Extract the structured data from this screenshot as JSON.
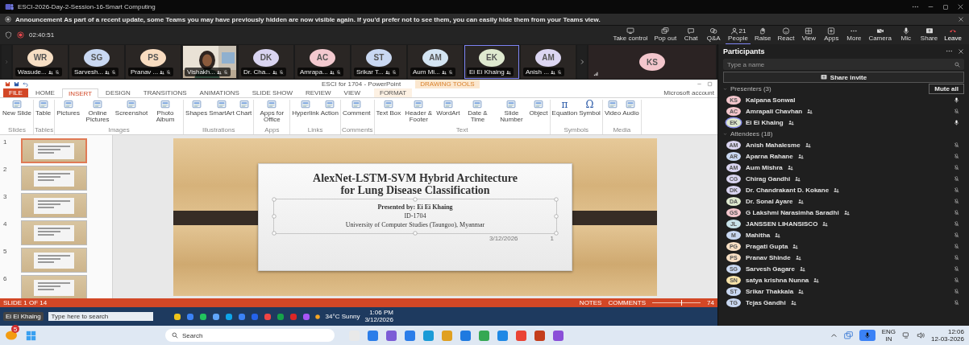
{
  "window": {
    "title": "ESCI-2026-Day-2-Session-16-Smart Computing"
  },
  "announcement": {
    "text": "Announcement As part of a recent update, some Teams you may have previously hidden are now visible again. If you'd prefer not to see them, you can easily hide them from your Teams view."
  },
  "meeting_bar": {
    "timer": "02:40:51",
    "actions": [
      {
        "label": "Take control",
        "selected": false
      },
      {
        "label": "Pop out",
        "selected": false
      },
      {
        "label": "Chat",
        "selected": false
      },
      {
        "label": "Q&A",
        "selected": false
      },
      {
        "label": "People",
        "count": "21",
        "selected": true
      },
      {
        "label": "Raise",
        "selected": false
      },
      {
        "label": "React",
        "selected": false
      },
      {
        "label": "View",
        "selected": false
      },
      {
        "label": "Apps",
        "selected": false
      },
      {
        "label": "More",
        "selected": false
      },
      {
        "label": "Camera",
        "selected": false
      },
      {
        "label": "Mic",
        "selected": false
      },
      {
        "label": "Share",
        "selected": false
      },
      {
        "label": "Leave",
        "selected": false
      }
    ]
  },
  "video_tiles": [
    {
      "kind": "avatar",
      "initials": "WR",
      "name": "Wasude...",
      "color": "#f7dfc4",
      "muted": true,
      "selected": false
    },
    {
      "kind": "avatar",
      "initials": "SG",
      "name": "Sarvesh...",
      "color": "#c9d8f2",
      "muted": true,
      "selected": false
    },
    {
      "kind": "avatar",
      "initials": "PS",
      "name": "Pranav ...",
      "color": "#f8dcc0",
      "muted": true,
      "selected": false
    },
    {
      "kind": "picture",
      "name": "Vishakh...",
      "muted": true,
      "selected": false
    },
    {
      "kind": "avatar",
      "initials": "DK",
      "name": "Dr. Cha...",
      "color": "#d9d4f0",
      "muted": true,
      "selected": false
    },
    {
      "kind": "avatar",
      "initials": "AC",
      "name": "Amrapa...",
      "color": "#f3c9cf",
      "muted": true,
      "selected": false
    },
    {
      "kind": "avatar",
      "initials": "ST",
      "name": "Srikar T...",
      "color": "#c9d8f2",
      "muted": true,
      "selected": false
    },
    {
      "kind": "avatar",
      "initials": "AM",
      "name": "Aum Mi...",
      "color": "#d3e4f2",
      "muted": true,
      "selected": false
    },
    {
      "kind": "avatar",
      "initials": "EK",
      "name": "Ei Ei Khaing",
      "color": "#dfe9cf",
      "muted": false,
      "selected": true
    },
    {
      "kind": "avatar",
      "initials": "AM",
      "name": "Anish ...",
      "color": "#dcd6f2",
      "muted": true,
      "selected": false
    }
  ],
  "featured_tile": {
    "initials": "KS",
    "color": "#f3c6cc"
  },
  "participants": {
    "title": "Participants",
    "search": {
      "placeholder": "Type a name"
    },
    "share_button": "Share invite",
    "mute_all": "Mute all",
    "groups": [
      {
        "label": "Presenters (3)",
        "members": [
          {
            "initials": "KS",
            "name": "Kalpana Sonwal",
            "color": "#f3c6cc",
            "badge": false,
            "muted": false,
            "speaking": false
          },
          {
            "initials": "AC",
            "name": "Amrapali Chavhan",
            "color": "#f3c6cc",
            "badge": true,
            "muted": true,
            "speaking": false
          },
          {
            "initials": "EK",
            "name": "Ei Ei Khaing",
            "color": "#dfe9cf",
            "badge": true,
            "muted": false,
            "speaking": true
          }
        ]
      },
      {
        "label": "Attendees (18)",
        "members": [
          {
            "initials": "AM",
            "name": "Anish Mahalesme",
            "color": "#d9d4f0",
            "badge": true,
            "muted": true,
            "speaking": false
          },
          {
            "initials": "AR",
            "name": "Aparna Rahane",
            "color": "#c9d8f2",
            "badge": true,
            "muted": true,
            "speaking": false
          },
          {
            "initials": "AM",
            "name": "Aum Mishra",
            "color": "#d9d4f0",
            "badge": true,
            "muted": true,
            "speaking": false
          },
          {
            "initials": "CG",
            "name": "Chirag Gandhi",
            "color": "#d9d4f0",
            "badge": true,
            "muted": true,
            "speaking": false
          },
          {
            "initials": "DK",
            "name": "Dr. Chandrakant D. Kokane",
            "color": "#d9d4f0",
            "badge": true,
            "muted": true,
            "speaking": false
          },
          {
            "initials": "DA",
            "name": "Dr. Sonal Ayare",
            "color": "#dfe9cf",
            "badge": true,
            "muted": true,
            "speaking": false
          },
          {
            "initials": "GS",
            "name": "G Lakshmi Narasimha Saradhi",
            "color": "#f3c6cc",
            "badge": true,
            "muted": true,
            "speaking": false
          },
          {
            "initials": "JL",
            "name": "JANSSEN LIHANSISCO",
            "color": "#c9e3ea",
            "badge": true,
            "muted": true,
            "speaking": false
          },
          {
            "initials": "M",
            "name": "Mahitha",
            "color": "#c9d8f2",
            "badge": true,
            "muted": true,
            "speaking": false
          },
          {
            "initials": "PG",
            "name": "Pragati Gupta",
            "color": "#f7dfc4",
            "badge": true,
            "muted": true,
            "speaking": false
          },
          {
            "initials": "PS",
            "name": "Pranav Shinde",
            "color": "#f7dfc4",
            "badge": true,
            "muted": true,
            "speaking": false
          },
          {
            "initials": "SG",
            "name": "Sarvesh Gagare",
            "color": "#c9d8f2",
            "badge": true,
            "muted": true,
            "speaking": false
          },
          {
            "initials": "SN",
            "name": "satya krishna Nunna",
            "color": "#f6e2a8",
            "badge": true,
            "muted": true,
            "speaking": false
          },
          {
            "initials": "ST",
            "name": "Srikar Thakkala",
            "color": "#c9d8f2",
            "badge": true,
            "muted": true,
            "speaking": false
          },
          {
            "initials": "TG",
            "name": "Tejas Gandhi",
            "color": "#c9d8f2",
            "badge": true,
            "muted": true,
            "speaking": false
          }
        ]
      }
    ]
  },
  "powerpoint": {
    "title": "ESCI for 1704 - PowerPoint",
    "contextual_label": "DRAWING TOOLS",
    "account": "Microsoft account",
    "tabs": [
      {
        "label": "FILE",
        "kind": "file",
        "selected": false
      },
      {
        "label": "HOME",
        "kind": "tab",
        "selected": false
      },
      {
        "label": "INSERT",
        "kind": "tab",
        "selected": true
      },
      {
        "label": "DESIGN",
        "kind": "tab",
        "selected": false
      },
      {
        "label": "TRANSITIONS",
        "kind": "tab",
        "selected": false
      },
      {
        "label": "ANIMATIONS",
        "kind": "tab",
        "selected": false
      },
      {
        "label": "SLIDE SHOW",
        "kind": "tab",
        "selected": false
      },
      {
        "label": "REVIEW",
        "kind": "tab",
        "selected": false
      },
      {
        "label": "VIEW",
        "kind": "tab",
        "selected": false
      },
      {
        "label": "FORMAT",
        "kind": "contextual",
        "selected": false
      }
    ],
    "ribbon_groups": [
      {
        "label": "Slides",
        "buttons": [
          {
            "label": "New Slide"
          }
        ]
      },
      {
        "label": "Tables",
        "buttons": [
          {
            "label": "Table"
          }
        ]
      },
      {
        "label": "Images",
        "buttons": [
          {
            "label": "Pictures"
          },
          {
            "label": "Online Pictures"
          },
          {
            "label": "Screenshot"
          },
          {
            "label": "Photo Album"
          }
        ]
      },
      {
        "label": "Illustrations",
        "buttons": [
          {
            "label": "Shapes"
          },
          {
            "label": "SmartArt"
          },
          {
            "label": "Chart"
          }
        ]
      },
      {
        "label": "Apps",
        "buttons": [
          {
            "label": "Apps for Office"
          }
        ]
      },
      {
        "label": "Links",
        "buttons": [
          {
            "label": "Hyperlink"
          },
          {
            "label": "Action"
          }
        ]
      },
      {
        "label": "Comments",
        "buttons": [
          {
            "label": "Comment"
          }
        ]
      },
      {
        "label": "Text",
        "buttons": [
          {
            "label": "Text Box"
          },
          {
            "label": "Header & Footer"
          },
          {
            "label": "WordArt"
          },
          {
            "label": "Date & Time"
          },
          {
            "label": "Slide Number"
          },
          {
            "label": "Object"
          }
        ]
      },
      {
        "label": "Symbols",
        "buttons": [
          {
            "label": "Equation",
            "glyph": "π"
          },
          {
            "label": "Symbol",
            "glyph": "Ω"
          }
        ]
      },
      {
        "label": "Media",
        "buttons": [
          {
            "label": "Video"
          },
          {
            "label": "Audio"
          }
        ]
      }
    ],
    "thumbnails": [
      {
        "number": "1",
        "selected": true
      },
      {
        "number": "2",
        "selected": false
      },
      {
        "number": "3",
        "selected": false
      },
      {
        "number": "4",
        "selected": false
      },
      {
        "number": "5",
        "selected": false
      },
      {
        "number": "6",
        "selected": false
      }
    ],
    "slide": {
      "title": "AlexNet-LSTM-SVM Hybrid Architecture for Lung Disease Classification",
      "lines": [
        "Presented by:  Ei Ei Khaing",
        "ID-1704",
        "University of Computer Studies (Taungoo), Myanmar"
      ],
      "date": "3/12/2026",
      "page": "1"
    },
    "status_bar": {
      "slide_count": "SLIDE 1 OF 14",
      "notes": "NOTES",
      "comments": "COMMENTS",
      "zoom": {
        "level": 0.6
      },
      "zoom_value": "74"
    },
    "inner_taskbar": {
      "presenter": "Ei Ei Khaing",
      "search": "Type here to search",
      "weather": "34°C Sunny",
      "time": "1:06 PM",
      "date": "3/12/2026"
    }
  },
  "taskbar": {
    "notification_count": "5",
    "search": "Search",
    "language": [
      "ENG",
      "IN"
    ],
    "time": "12:06",
    "date": "12-03-2026"
  }
}
